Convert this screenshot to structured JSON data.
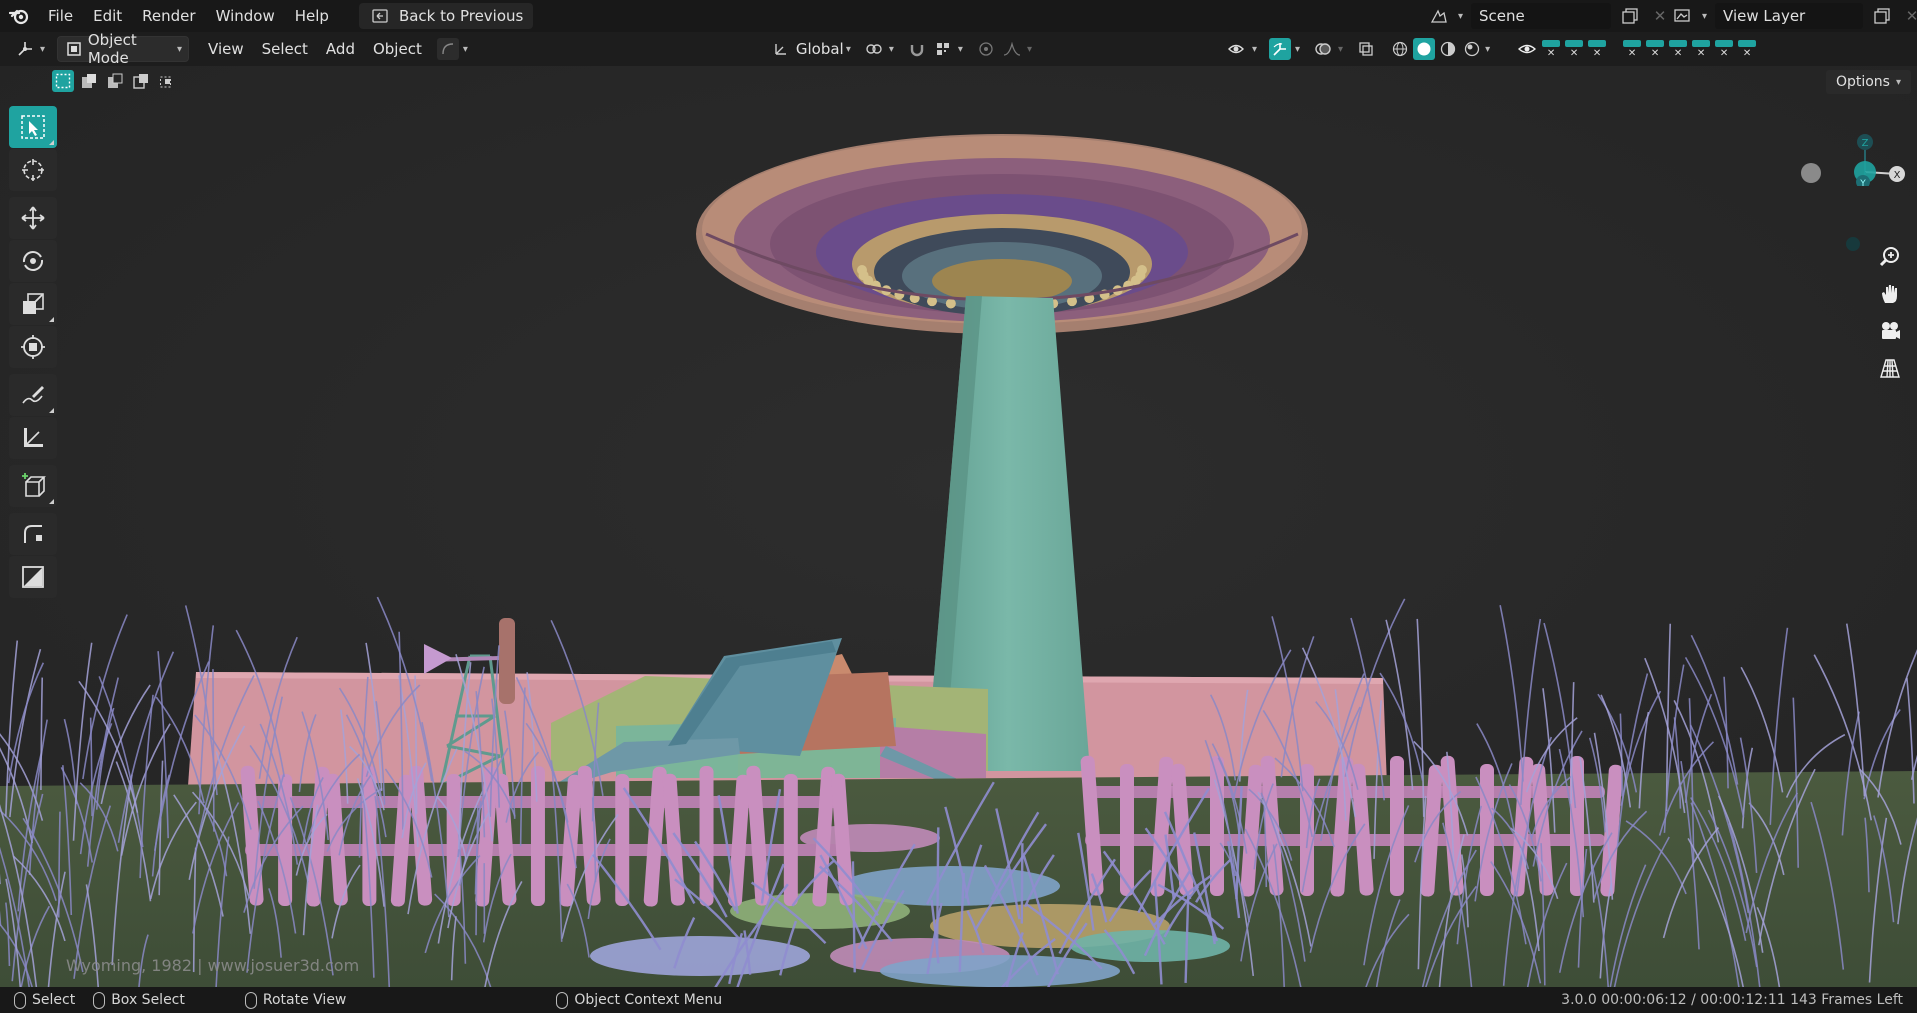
{
  "topbar": {
    "menus": [
      "File",
      "Edit",
      "Render",
      "Window",
      "Help"
    ],
    "back_label": "Back to Previous",
    "scene_label": "Scene",
    "view_layer_label": "View Layer"
  },
  "header": {
    "mode_label": "Object Mode",
    "menus": [
      "View",
      "Select",
      "Add",
      "Object"
    ],
    "transform_orientation": "Global",
    "options_label": "Options"
  },
  "toolbar": {
    "tools": [
      "select-box",
      "cursor",
      "move",
      "rotate",
      "scale",
      "transform",
      "annotate",
      "measure",
      "add-cube",
      "shear",
      "edit"
    ]
  },
  "navigation": {
    "axes": [
      "Z",
      "X",
      "Y"
    ]
  },
  "viewport": {
    "watermark": "Wyoming, 1982  |  www.josuer3d.com"
  },
  "statusbar": {
    "select_label": "Select",
    "box_select_label": "Box Select",
    "rotate_label": "Rotate View",
    "context_label": "Object Context Menu",
    "info": "3.0.0   00:00:06:12 / 00:00:12:11   143 Frames Left"
  },
  "colors": {
    "accent": "#1fa3a0",
    "beam": "#74b2a3",
    "fence": "#c98fbf",
    "wall": "#d2959f",
    "car": "#b7c37e",
    "barn_roof": "#5f8f9f",
    "grass": "#8a88c6"
  }
}
